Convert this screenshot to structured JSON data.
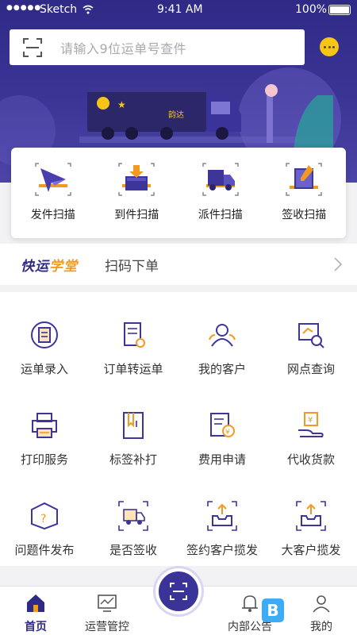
{
  "status": {
    "signal": "●●●●●",
    "carrier": "Sketch",
    "time": "9:41 AM",
    "battery": "100%"
  },
  "search": {
    "placeholder": "请输入9位运单号查件"
  },
  "truck_label": "韵达",
  "quick_actions": [
    {
      "label": "发件扫描",
      "icon": "send-plane-icon"
    },
    {
      "label": "到件扫描",
      "icon": "inbox-arrive-icon"
    },
    {
      "label": "派件扫描",
      "icon": "delivery-truck-icon"
    },
    {
      "label": "签收扫描",
      "icon": "sign-book-icon"
    }
  ],
  "school": {
    "brand_a": "快运",
    "brand_b": "学堂",
    "text": "扫码下单"
  },
  "grid": [
    {
      "label": "运单录入",
      "icon": "waybill-entry-icon"
    },
    {
      "label": "订单转运单",
      "icon": "order-convert-icon"
    },
    {
      "label": "我的客户",
      "icon": "customers-icon"
    },
    {
      "label": "网点查询",
      "icon": "outlet-search-icon"
    },
    {
      "label": "打印服务",
      "icon": "printer-icon"
    },
    {
      "label": "标签补打",
      "icon": "label-reprint-icon"
    },
    {
      "label": "费用申请",
      "icon": "fee-apply-icon"
    },
    {
      "label": "代收货款",
      "icon": "cod-collect-icon"
    },
    {
      "label": "问题件发布",
      "icon": "problem-parcel-icon"
    },
    {
      "label": "是否签收",
      "icon": "sign-status-icon"
    },
    {
      "label": "签约客户揽发",
      "icon": "contract-pickup-icon"
    },
    {
      "label": "大客户揽发",
      "icon": "vip-pickup-icon"
    }
  ],
  "tabs": [
    {
      "label": "首页",
      "icon": "home-icon"
    },
    {
      "label": "运营管控",
      "icon": "monitor-icon"
    },
    {
      "label": "内部公告",
      "icon": "bell-icon"
    },
    {
      "label": "我的",
      "icon": "user-icon"
    }
  ],
  "colors": {
    "primary": "#2f2a86",
    "accent": "#f29a1f",
    "hero_bg": "#3b3596"
  }
}
